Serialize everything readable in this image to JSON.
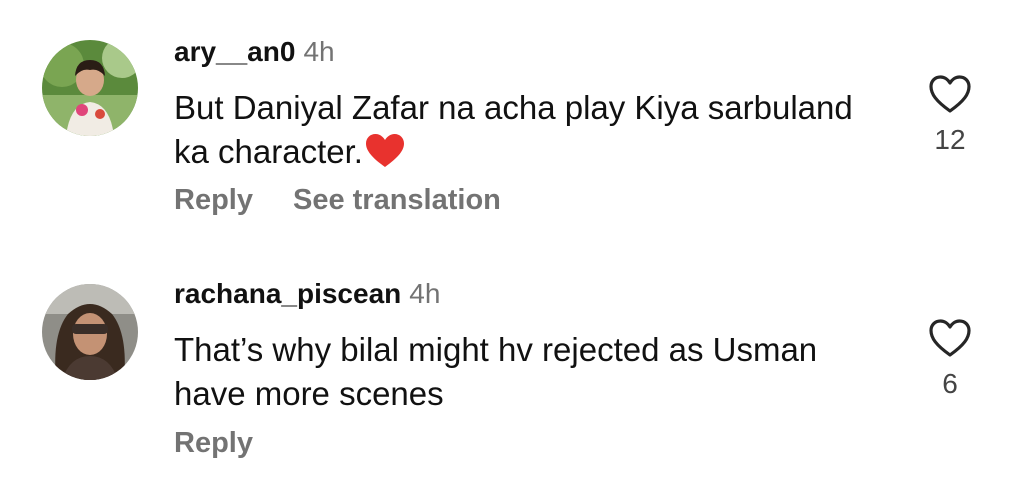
{
  "comments": [
    {
      "username": "ary__an0",
      "time": "4h",
      "text": "But Daniyal Zafar na acha play Kiya sarbuland ka character.",
      "emoji": "red-heart",
      "reply_label": "Reply",
      "translate_label": "See translation",
      "likes": "12",
      "like_icon": "heart-outline-icon"
    },
    {
      "username": "rachana_piscean",
      "time": "4h",
      "text": "That’s why bilal might hv rejected as Usman have more scenes",
      "reply_label": "Reply",
      "likes": "6",
      "like_icon": "heart-outline-icon"
    }
  ],
  "colors": {
    "secondary_text": "#737373",
    "heart_emoji": "#e8322e"
  }
}
